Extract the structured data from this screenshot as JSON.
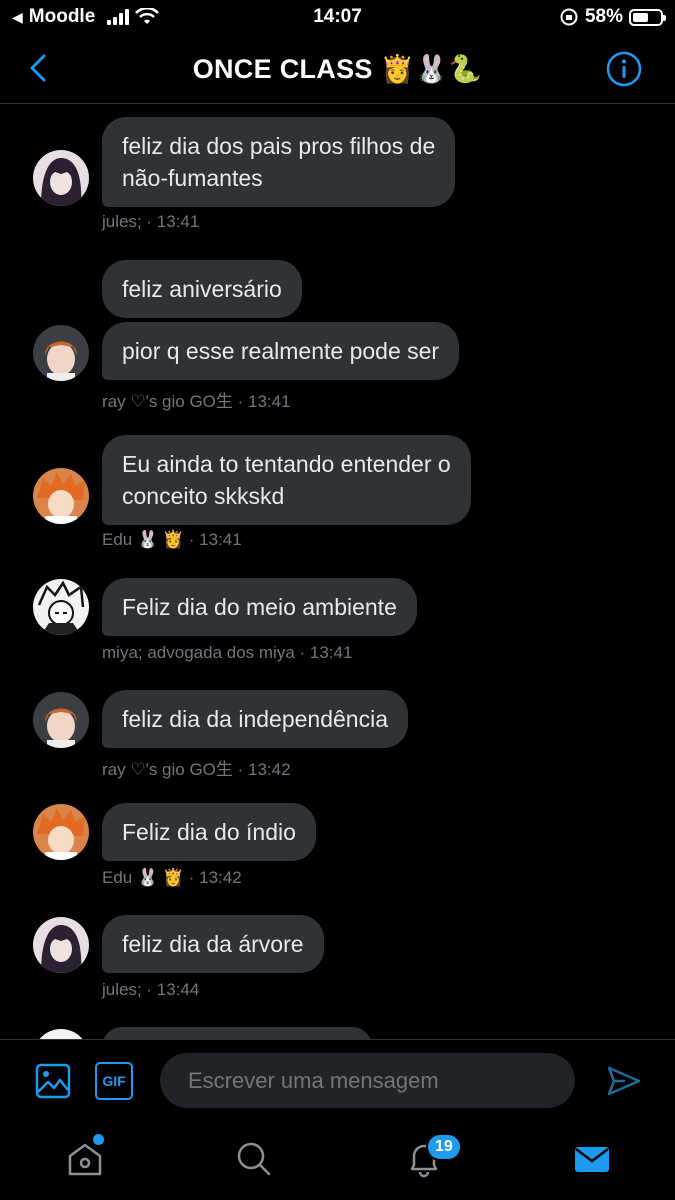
{
  "status": {
    "carrier": "Moodle",
    "time": "14:07",
    "battery": "58%",
    "battery_level": 0.58
  },
  "header": {
    "title": "ONCE CLASS 👸🐰🐍",
    "back_icon": "chevron-left-icon",
    "info_icon": "info-icon"
  },
  "messages": [
    {
      "bubbles": [
        "feliz dia dos pais pros filhos de\nnão-fumantes"
      ],
      "meta": "jules; · 13:41",
      "avatar": "girl-dark-hair"
    },
    {
      "bubbles": [
        "feliz aniversário",
        "pior q esse realmente pode ser"
      ],
      "meta": "ray ♡'s gio GO生 · 13:41",
      "avatar": "boy-orange-hair"
    },
    {
      "bubbles": [
        "Eu ainda to tentando entender o\nconceito skkskd"
      ],
      "meta": "Edu 🐰 👸 · 13:41",
      "avatar": "anime-orange"
    },
    {
      "bubbles": [
        "Feliz dia do meio ambiente"
      ],
      "meta": "miya; advogada dos miya · 13:41",
      "avatar": "manga-bw"
    },
    {
      "bubbles": [
        "feliz dia da independência"
      ],
      "meta": "ray ♡'s gio GO生 · 13:42",
      "avatar": "boy-orange-hair"
    },
    {
      "bubbles": [
        "Feliz dia do índio"
      ],
      "meta": "Edu 🐰 👸 · 13:42",
      "avatar": "anime-orange"
    },
    {
      "bubbles": [
        "feliz dia da árvore"
      ],
      "meta": "jules; · 13:44",
      "avatar": "girl-dark-hair"
    }
  ],
  "composer": {
    "placeholder": "Escrever uma mensagem",
    "image_icon": "image-icon",
    "gif_label": "GIF",
    "send_icon": "send-icon"
  },
  "tabbar": {
    "notifications_count": "19",
    "icons": [
      "home-icon",
      "search-icon",
      "bell-icon",
      "mail-icon"
    ]
  },
  "colors": {
    "accent": "#1d9bf0",
    "bubble": "#2f3336",
    "background": "#000000",
    "meta_text": "#71767b"
  }
}
